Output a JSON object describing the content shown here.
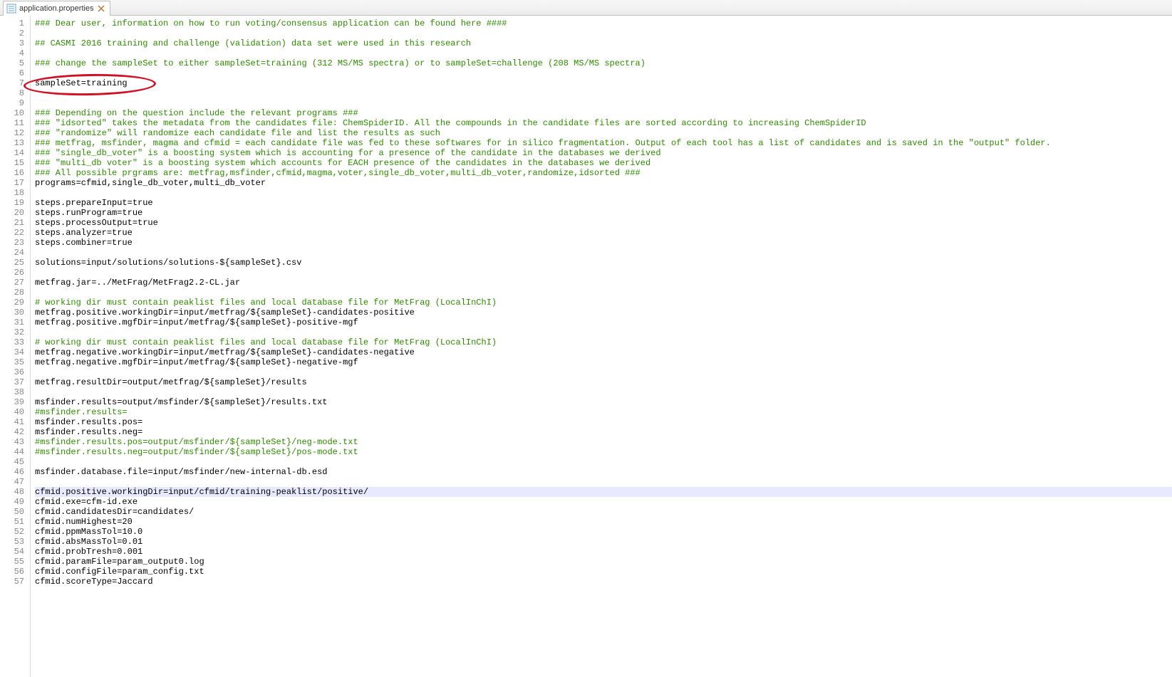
{
  "tab": {
    "filename": "application.properties",
    "close": "×"
  },
  "lines": [
    {
      "n": 1,
      "cls": "comment",
      "t": "### Dear user, information on how to run voting/consensus application can be found here ####"
    },
    {
      "n": 2,
      "cls": "",
      "t": ""
    },
    {
      "n": 3,
      "cls": "comment",
      "t": "## CASMI 2016 training and challenge (validation) data set were used in this research"
    },
    {
      "n": 4,
      "cls": "",
      "t": ""
    },
    {
      "n": 5,
      "cls": "comment",
      "t": "### change the sampleSet to either sampleSet=training (312 MS/MS spectra) or to sampleSet=challenge (208 MS/MS spectra)"
    },
    {
      "n": 6,
      "cls": "",
      "t": ""
    },
    {
      "n": 7,
      "cls": "",
      "t": "sampleSet=training"
    },
    {
      "n": 8,
      "cls": "",
      "t": ""
    },
    {
      "n": 9,
      "cls": "",
      "t": ""
    },
    {
      "n": 10,
      "cls": "comment",
      "t": "### Depending on the question include the relevant programs ###"
    },
    {
      "n": 11,
      "cls": "comment",
      "t": "### \"idsorted\" takes the metadata from the candidates file: ChemSpiderID. All the compounds in the candidate files are sorted according to increasing ChemSpiderID"
    },
    {
      "n": 12,
      "cls": "comment",
      "t": "### \"randomize\" will randomize each candidate file and list the results as such"
    },
    {
      "n": 13,
      "cls": "comment",
      "t": "### metfrag, msfinder, magma and cfmid = each candidate file was fed to these softwares for in silico fragmentation. Output of each tool has a list of candidates and is saved in the \"output\" folder."
    },
    {
      "n": 14,
      "cls": "comment",
      "t": "### \"single_db_voter\" is a boosting system which is accounting for a presence of the candidate in the databases we derived"
    },
    {
      "n": 15,
      "cls": "comment",
      "t": "### \"multi_db voter\" is a boosting system which accounts for EACH presence of the candidates in the databases we derived"
    },
    {
      "n": 16,
      "cls": "comment",
      "t": "### All possible prgrams are: metfrag,msfinder,cfmid,magma,voter,single_db_voter,multi_db_voter,randomize,idsorted ###"
    },
    {
      "n": 17,
      "cls": "",
      "t": "programs=cfmid,single_db_voter,multi_db_voter"
    },
    {
      "n": 18,
      "cls": "",
      "t": ""
    },
    {
      "n": 19,
      "cls": "",
      "t": "steps.prepareInput=true"
    },
    {
      "n": 20,
      "cls": "",
      "t": "steps.runProgram=true"
    },
    {
      "n": 21,
      "cls": "",
      "t": "steps.processOutput=true"
    },
    {
      "n": 22,
      "cls": "",
      "t": "steps.analyzer=true"
    },
    {
      "n": 23,
      "cls": "",
      "t": "steps.combiner=true"
    },
    {
      "n": 24,
      "cls": "",
      "t": ""
    },
    {
      "n": 25,
      "cls": "",
      "t": "solutions=input/solutions/solutions-${sampleSet}.csv"
    },
    {
      "n": 26,
      "cls": "",
      "t": ""
    },
    {
      "n": 27,
      "cls": "",
      "t": "metfrag.jar=../MetFrag/MetFrag2.2-CL.jar"
    },
    {
      "n": 28,
      "cls": "",
      "t": ""
    },
    {
      "n": 29,
      "cls": "comment",
      "t": "# working dir must contain peaklist files and local database file for MetFrag (LocalInChI)"
    },
    {
      "n": 30,
      "cls": "",
      "t": "metfrag.positive.workingDir=input/metfrag/${sampleSet}-candidates-positive"
    },
    {
      "n": 31,
      "cls": "",
      "t": "metfrag.positive.mgfDir=input/metfrag/${sampleSet}-positive-mgf"
    },
    {
      "n": 32,
      "cls": "",
      "t": ""
    },
    {
      "n": 33,
      "cls": "comment",
      "t": "# working dir must contain peaklist files and local database file for MetFrag (LocalInChI)"
    },
    {
      "n": 34,
      "cls": "",
      "t": "metfrag.negative.workingDir=input/metfrag/${sampleSet}-candidates-negative"
    },
    {
      "n": 35,
      "cls": "",
      "t": "metfrag.negative.mgfDir=input/metfrag/${sampleSet}-negative-mgf"
    },
    {
      "n": 36,
      "cls": "",
      "t": ""
    },
    {
      "n": 37,
      "cls": "",
      "t": "metfrag.resultDir=output/metfrag/${sampleSet}/results"
    },
    {
      "n": 38,
      "cls": "",
      "t": ""
    },
    {
      "n": 39,
      "cls": "",
      "t": "msfinder.results=output/msfinder/${sampleSet}/results.txt"
    },
    {
      "n": 40,
      "cls": "comment",
      "t": "#msfinder.results="
    },
    {
      "n": 41,
      "cls": "",
      "t": "msfinder.results.pos="
    },
    {
      "n": 42,
      "cls": "",
      "t": "msfinder.results.neg="
    },
    {
      "n": 43,
      "cls": "comment",
      "t": "#msfinder.results.pos=output/msfinder/${sampleSet}/neg-mode.txt"
    },
    {
      "n": 44,
      "cls": "comment",
      "t": "#msfinder.results.neg=output/msfinder/${sampleSet}/pos-mode.txt"
    },
    {
      "n": 45,
      "cls": "",
      "t": ""
    },
    {
      "n": 46,
      "cls": "",
      "t": "msfinder.database.file=input/msfinder/new-internal-db.esd"
    },
    {
      "n": 47,
      "cls": "",
      "t": ""
    },
    {
      "n": 48,
      "cls": "hl",
      "t": "cfmid.positive.workingDir=input/cfmid/training-peaklist/positive/"
    },
    {
      "n": 49,
      "cls": "",
      "t": "cfmid.exe=cfm-id.exe"
    },
    {
      "n": 50,
      "cls": "",
      "t": "cfmid.candidatesDir=candidates/"
    },
    {
      "n": 51,
      "cls": "",
      "t": "cfmid.numHighest=20"
    },
    {
      "n": 52,
      "cls": "",
      "t": "cfmid.ppmMassTol=10.0"
    },
    {
      "n": 53,
      "cls": "",
      "t": "cfmid.absMassTol=0.01"
    },
    {
      "n": 54,
      "cls": "",
      "t": "cfmid.probTresh=0.001"
    },
    {
      "n": 55,
      "cls": "",
      "t": "cfmid.paramFile=param_output0.log"
    },
    {
      "n": 56,
      "cls": "",
      "t": "cfmid.configFile=param_config.txt"
    },
    {
      "n": 57,
      "cls": "",
      "t": "cfmid.scoreType=Jaccard"
    }
  ],
  "ellipse_line": 7
}
